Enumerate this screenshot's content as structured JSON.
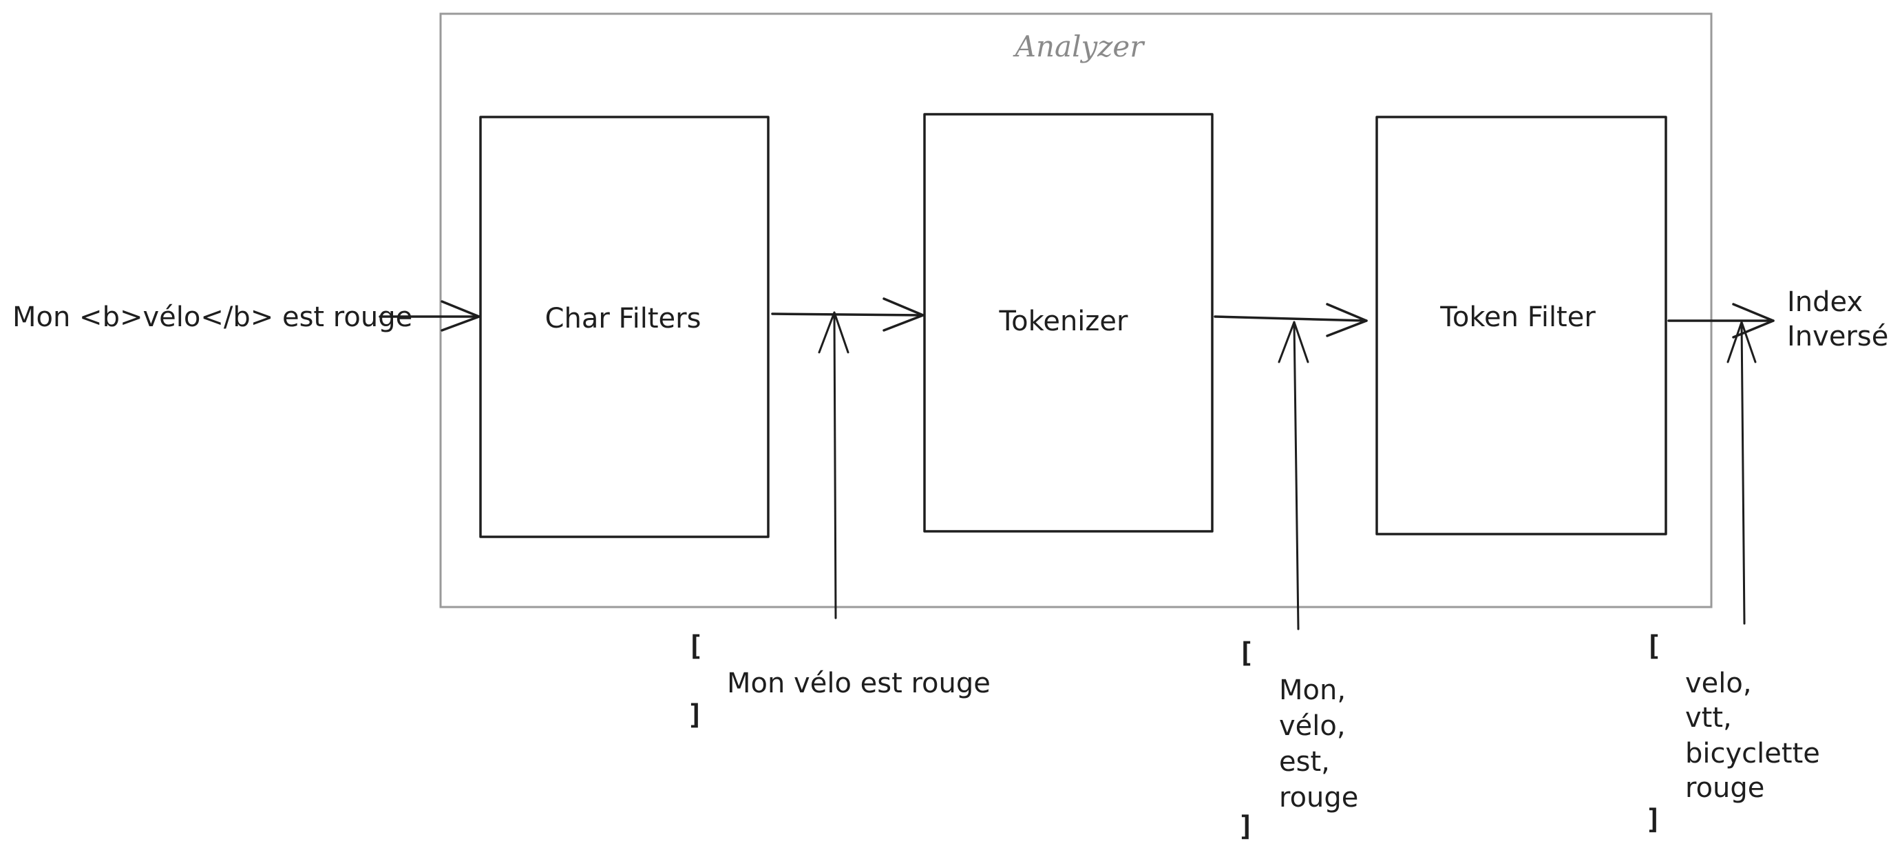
{
  "analyzer": {
    "title": "Analyzer"
  },
  "input": {
    "text": "Mon <b>vélo</b> est rouge"
  },
  "stages": [
    {
      "label": "Char Filters"
    },
    {
      "label": "Tokenizer"
    },
    {
      "label": "Token Filter"
    }
  ],
  "output": {
    "line1": "Index",
    "line2": "Inversé"
  },
  "annotations": {
    "after_char_filters": {
      "open": "[",
      "items": [
        "Mon vélo est rouge"
      ],
      "close": "]"
    },
    "after_tokenizer": {
      "open": "[",
      "items": [
        "Mon,",
        "vélo,",
        "est,",
        "rouge"
      ],
      "close": "]"
    },
    "after_token_filter": {
      "open": "[",
      "items": [
        "velo,",
        "vtt,",
        "bicyclette",
        "rouge"
      ],
      "close": "]"
    }
  }
}
